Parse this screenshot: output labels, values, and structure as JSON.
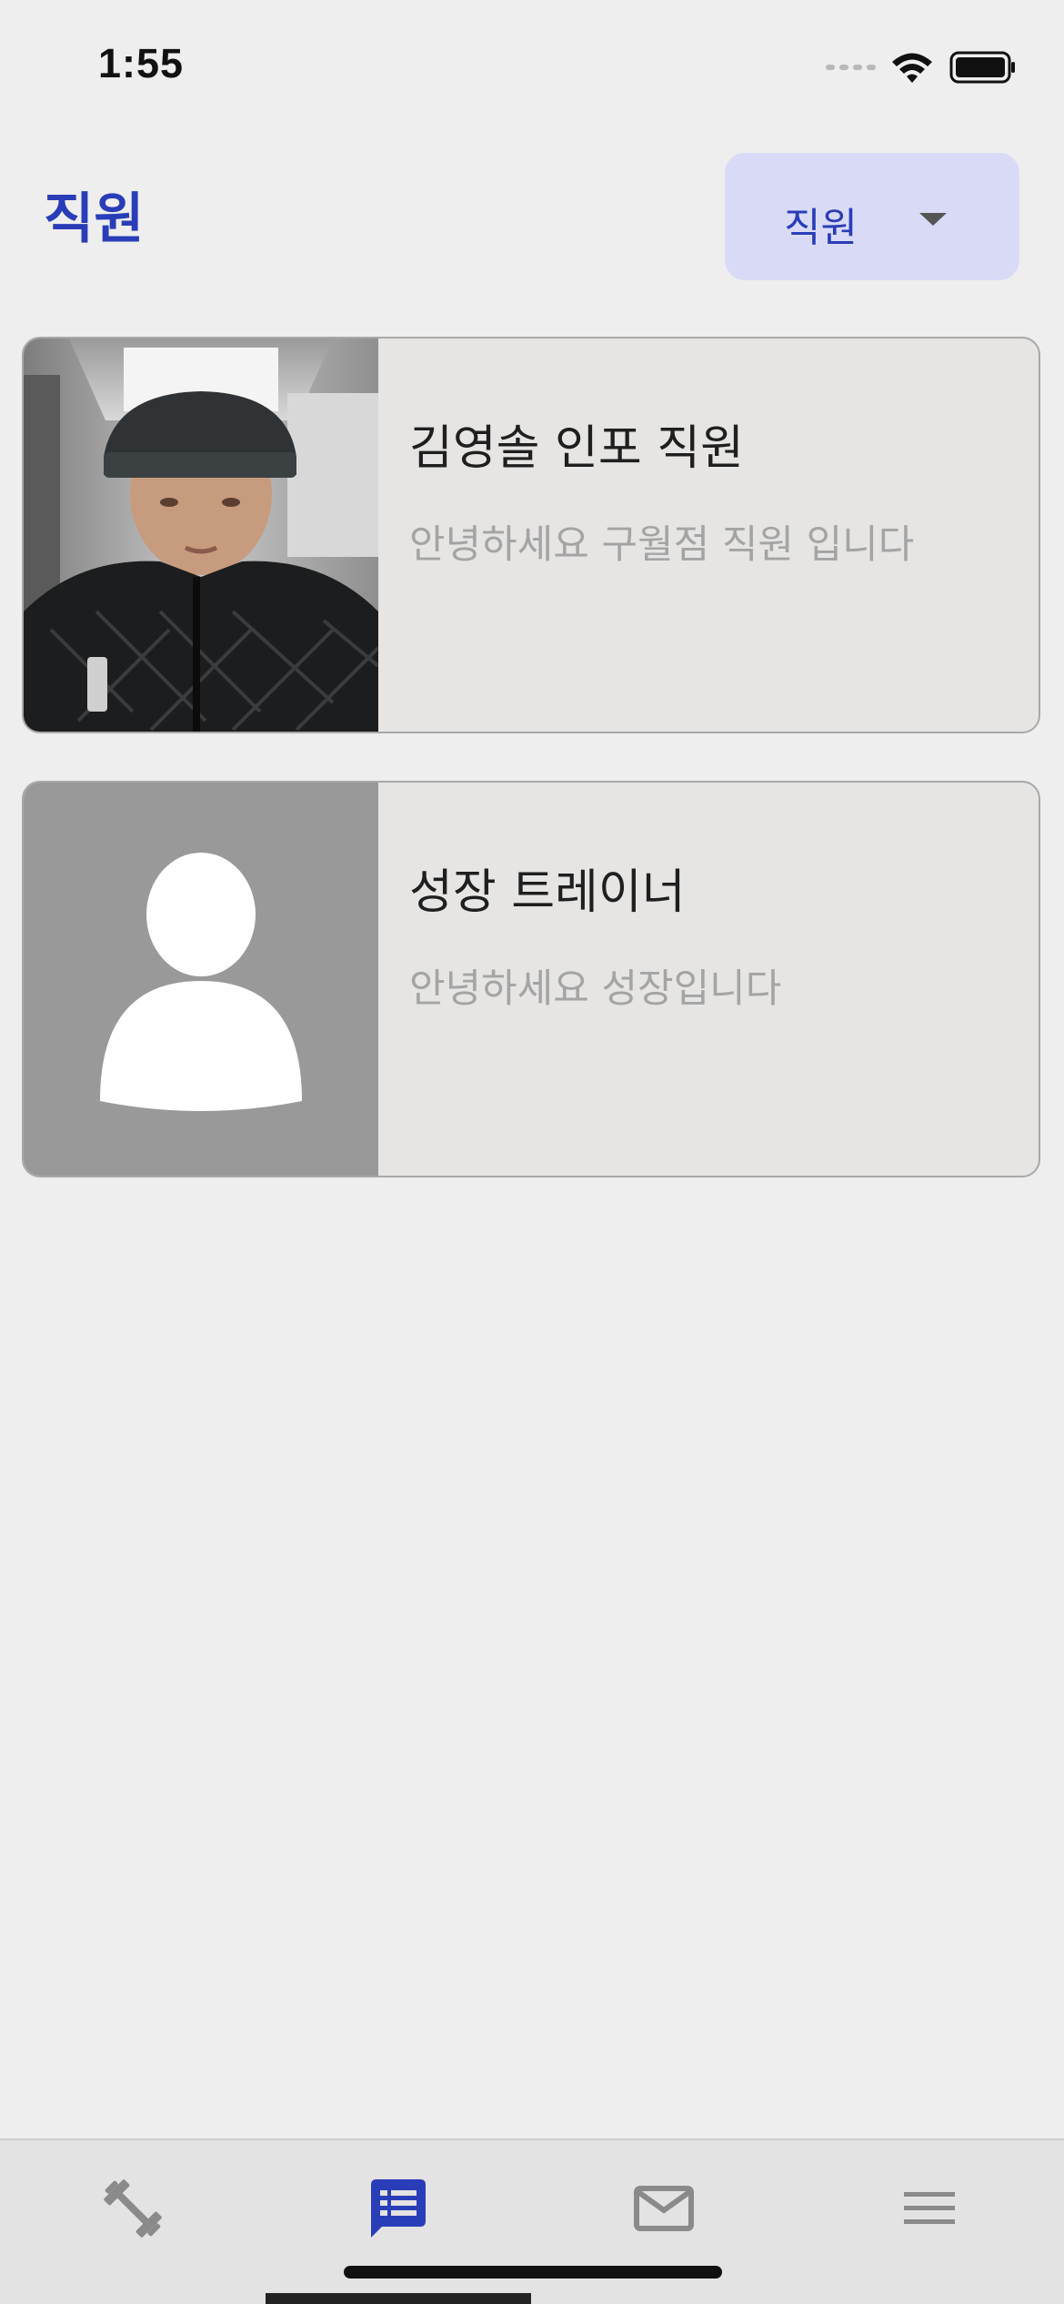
{
  "status_bar": {
    "time": "1:55"
  },
  "header": {
    "title": "직원",
    "role_filter": {
      "selected": "직원"
    }
  },
  "staff_list": [
    {
      "name": "김영솔 인포 직원",
      "description": "안녕하세요 구월점 직원 입니다",
      "photo": "profile-photo"
    },
    {
      "name": "성장 트레이너",
      "description": "안녕하세요 성장입니다",
      "photo": "default-avatar-icon"
    }
  ],
  "tab_bar": {
    "tabs": [
      {
        "icon": "dumbbell-icon",
        "active": false
      },
      {
        "icon": "feed-list-icon",
        "active": true
      },
      {
        "icon": "mail-icon",
        "active": false
      },
      {
        "icon": "menu-icon",
        "active": false
      }
    ],
    "active_color": "#2a3db8",
    "inactive_color": "#8a8a8a"
  }
}
